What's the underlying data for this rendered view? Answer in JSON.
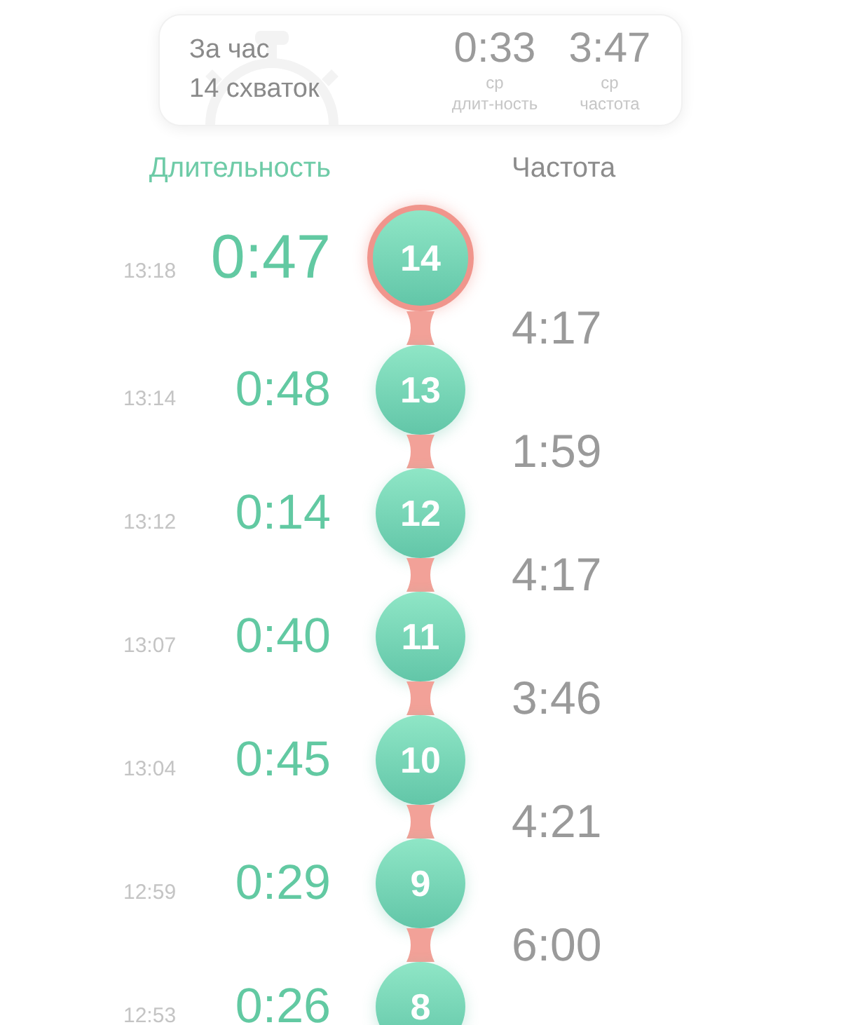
{
  "summary": {
    "period": "За час",
    "count": "14 схваток",
    "stats": [
      {
        "value": "0:33",
        "caption_top": "ср",
        "caption_bottom": "длит-ность"
      },
      {
        "value": "3:47",
        "caption_top": "ср",
        "caption_bottom": "частота"
      }
    ]
  },
  "headers": {
    "duration": "Длительность",
    "frequency": "Частота"
  },
  "contractions": [
    {
      "number": "14",
      "time": "13:18",
      "duration": "0:47",
      "selected": true
    },
    {
      "number": "13",
      "time": "13:14",
      "duration": "0:48",
      "selected": false,
      "frequency": "4:17"
    },
    {
      "number": "12",
      "time": "13:12",
      "duration": "0:14",
      "selected": false,
      "frequency": "1:59"
    },
    {
      "number": "11",
      "time": "13:07",
      "duration": "0:40",
      "selected": false,
      "frequency": "4:17"
    },
    {
      "number": "10",
      "time": "13:04",
      "duration": "0:45",
      "selected": false,
      "frequency": "3:46"
    },
    {
      "number": "9",
      "time": "12:59",
      "duration": "0:29",
      "selected": false,
      "frequency": "4:21"
    },
    {
      "number": "8",
      "time": "12:53",
      "duration": "0:26",
      "selected": false,
      "frequency": "6:00"
    }
  ]
}
